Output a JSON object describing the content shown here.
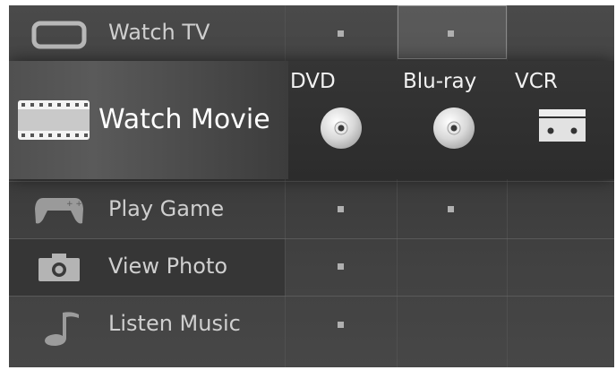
{
  "menu": {
    "watch_tv": {
      "label": "Watch TV",
      "icon": "tv-icon"
    },
    "watch_movie": {
      "label": "Watch Movie",
      "icon": "film-strip-icon",
      "sources": [
        {
          "label": "DVD",
          "icon": "disc-icon"
        },
        {
          "label": "Blu-ray",
          "icon": "disc-icon"
        },
        {
          "label": "VCR",
          "icon": "vcr-tape-icon"
        }
      ]
    },
    "play_game": {
      "label": "Play Game",
      "icon": "gamepad-icon"
    },
    "view_photo": {
      "label": "View Photo",
      "icon": "camera-icon"
    },
    "listen_music": {
      "label": "Listen Music",
      "icon": "music-note-icon"
    }
  },
  "colors": {
    "background": "#3f3f3f",
    "selected_row": "#2e2e2e",
    "text": "#cfcfcf",
    "selected_text": "#ffffff"
  }
}
